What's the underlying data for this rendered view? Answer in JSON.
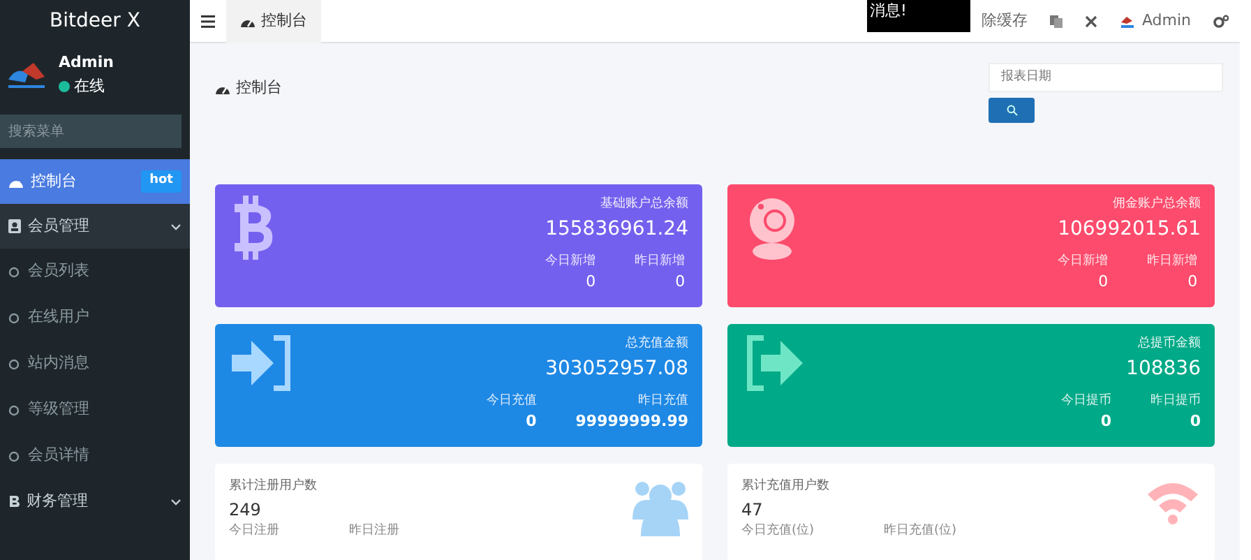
{
  "sidebar": {
    "brand": "Bitdeer X",
    "user": {
      "name": "Admin",
      "status": "在线",
      "online": true
    },
    "search": {
      "placeholder": "搜索菜单"
    },
    "items": [
      {
        "label": "控制台",
        "selected": true,
        "badge": "hot"
      },
      {
        "label": "会员管理",
        "selected": false,
        "children": [
          {
            "label": "会员列表"
          },
          {
            "label": "在线用户"
          },
          {
            "label": "站内消息"
          },
          {
            "label": "等级管理"
          },
          {
            "label": "会员详情"
          }
        ]
      },
      {
        "label": "财务管理",
        "selected": false
      }
    ]
  },
  "topbar": {
    "tabs": [
      {
        "label": "控制台",
        "selected": true
      }
    ],
    "notice": "消息!",
    "clear_cache": "除缓存",
    "user": "Admin"
  },
  "page": {
    "title": "控制台",
    "date_field": {
      "placeholder": "报表日期"
    }
  },
  "stat_cards": [
    {
      "title": "基础账户总余额",
      "value": "155836961.24",
      "color": "#7460ee",
      "bold_values": false,
      "sub": [
        {
          "label": "今日新增",
          "value": "0"
        },
        {
          "label": "昨日新增",
          "value": "0"
        }
      ]
    },
    {
      "title": "佣金账户总余额",
      "value": "106992015.61",
      "color": "#fc4b6c",
      "bold_values": false,
      "sub": [
        {
          "label": "今日新增",
          "value": "0"
        },
        {
          "label": "昨日新增",
          "value": "0"
        }
      ]
    },
    {
      "title": "总充值金额",
      "value": "303052957.08",
      "color": "#1e88e5",
      "bold_values": true,
      "sub": [
        {
          "label": "今日充值",
          "value": "0"
        },
        {
          "label": "昨日充值",
          "value": "99999999.99"
        }
      ]
    },
    {
      "title": "总提币金额",
      "value": "108836",
      "color": "#00a987",
      "bold_values": true,
      "sub": [
        {
          "label": "今日提币",
          "value": "0"
        },
        {
          "label": "昨日提币",
          "value": "0"
        }
      ]
    }
  ],
  "user_cards": [
    {
      "title": "累计注册用户数",
      "value": "249",
      "sub": [
        "今日注册",
        "昨日注册"
      ]
    },
    {
      "title": "累计充值用户数",
      "value": "47",
      "sub": [
        "今日充值(位)",
        "昨日充值(位)"
      ]
    }
  ]
}
